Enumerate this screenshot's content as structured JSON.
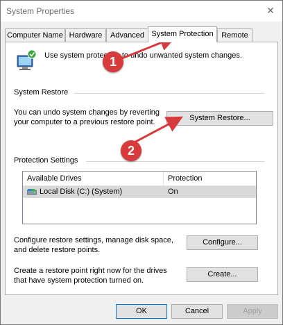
{
  "window": {
    "title": "System Properties",
    "close_glyph": "✕"
  },
  "tabs": [
    {
      "label": "Computer Name"
    },
    {
      "label": "Hardware"
    },
    {
      "label": "Advanced"
    },
    {
      "label": "System Protection"
    },
    {
      "label": "Remote"
    }
  ],
  "active_tab": "System Protection",
  "intro_text": "Use system protection to undo unwanted system changes.",
  "system_restore": {
    "heading": "System Restore",
    "description": "You can undo system changes by reverting your computer to a previous restore point.",
    "button_label": "System Restore..."
  },
  "protection": {
    "heading": "Protection Settings",
    "columns": [
      "Available Drives",
      "Protection"
    ],
    "rows": [
      {
        "drive": "Local Disk (C:) (System)",
        "protection": "On"
      }
    ]
  },
  "configure": {
    "description": "Configure restore settings, manage disk space, and delete restore points.",
    "button_label": "Configure..."
  },
  "create": {
    "description": "Create a restore point right now for the drives that have system protection turned on.",
    "button_label": "Create..."
  },
  "footer": {
    "ok": "OK",
    "cancel": "Cancel",
    "apply": "Apply"
  },
  "annotations": [
    {
      "number": "1"
    },
    {
      "number": "2"
    }
  ],
  "colors": {
    "badge": "#d83b3b",
    "arrow": "#d83b3b",
    "focus": "#0078d7"
  }
}
